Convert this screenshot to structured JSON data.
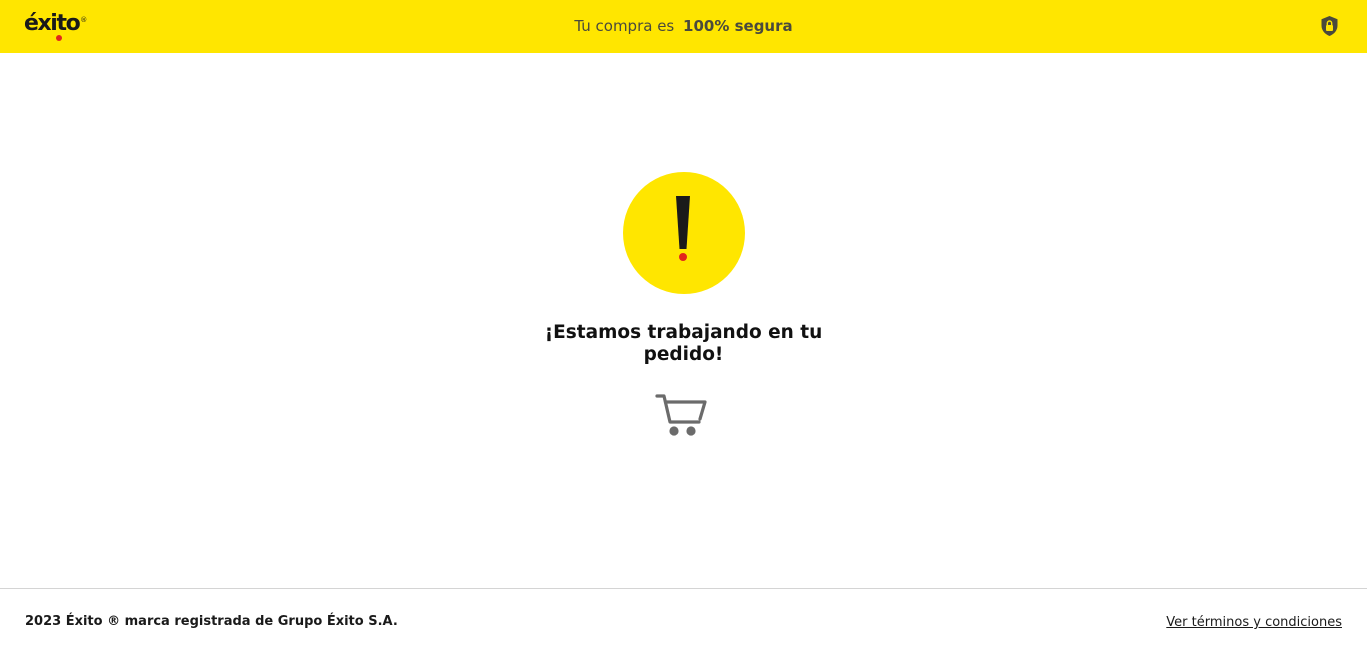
{
  "header": {
    "logo_text": "éxito",
    "logo_reg_mark": "®",
    "secure_prefix": "Tu compra es",
    "secure_strong": "100% segura",
    "icons": {
      "secure": "shield-lock-icon"
    }
  },
  "main": {
    "alert_icon": "exclamation-icon",
    "headline": "¡Estamos trabajando en tu pedido!",
    "cart_icon": "shopping-cart-icon"
  },
  "footer": {
    "copyright": "2023 Éxito ® marca registrada de Grupo Éxito S.A.",
    "terms_link": "Ver términos y condiciones"
  },
  "colors": {
    "brand_yellow": "#ffe600",
    "brand_red": "#e2261c",
    "text_dark": "#1a1a1a",
    "icon_gray": "#6b6b6b"
  }
}
